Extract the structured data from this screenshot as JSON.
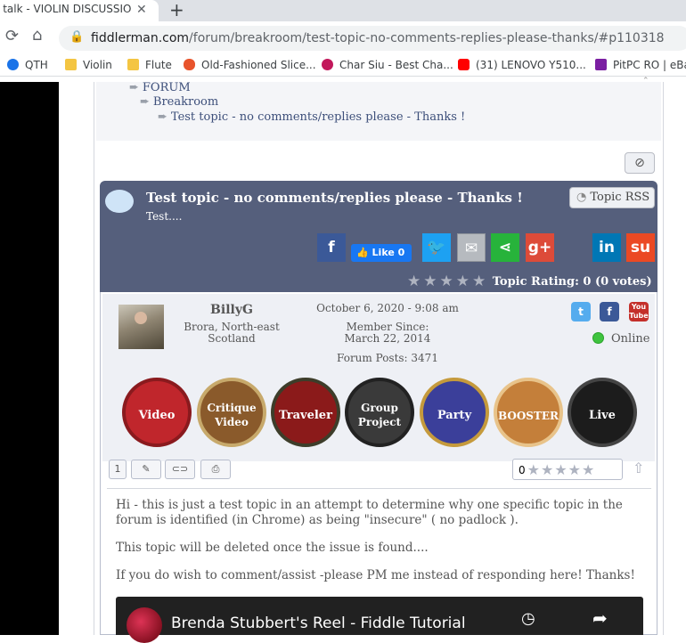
{
  "browser": {
    "tab_title": "e talk - VIOLIN DISCUSSION",
    "tab_close": "✕",
    "new_tab": "+",
    "url_host": "fiddlerman.com",
    "url_path": "/forum/breakroom/test-topic-no-comments-replies-please-thanks/#p110318",
    "bookmarks": [
      {
        "label": "QTH",
        "color": "#1a73e8"
      },
      {
        "label": "Violin",
        "color": "#f4c542"
      },
      {
        "label": "Flute",
        "color": "#f4c542"
      },
      {
        "label": "Old-Fashioned Slice...",
        "color": "#e8542c"
      },
      {
        "label": "Char Siu - Best Cha...",
        "color": "#c2185b"
      },
      {
        "label": "(31) LENOVO Y510...",
        "color": "#ff0000"
      },
      {
        "label": "PitPC RO | eBay",
        "color": "#7b1fa2"
      }
    ]
  },
  "breadcrumb": {
    "root": "FORUM",
    "section": "Breakroom",
    "topic": "Test topic - no comments/replies please - Thanks !"
  },
  "topic": {
    "title": "Test topic - no comments/replies please - Thanks !",
    "subtitle": "Test....",
    "rss_label": "Topic RSS",
    "fb_like": "Like 0",
    "rating_label": "Topic Rating: 0 (0 votes)",
    "share_buttons": [
      {
        "name": "facebook-share-button",
        "glyph": "f",
        "color": "#3b5998"
      },
      {
        "name": "twitter-share-button",
        "glyph": "t",
        "color": "#1da1f2"
      },
      {
        "name": "email-share-button",
        "glyph": "✉",
        "color": "#b6babf"
      },
      {
        "name": "sharethis-share-button",
        "glyph": "<",
        "color": "#27b33b"
      },
      {
        "name": "googleplus-share-button",
        "glyph": "g+",
        "color": "#dd4b39"
      },
      {
        "name": "linkedin-share-button",
        "glyph": "in",
        "color": "#0077b5"
      },
      {
        "name": "stumbleupon-share-button",
        "glyph": "su",
        "color": "#eb4924"
      }
    ]
  },
  "post": {
    "author": "BillyG",
    "location": "Brora, North-east Scotland",
    "date": "October 6, 2020 - 9:08 am",
    "member_since": "Member Since: March 22, 2014",
    "forum_posts": "Forum Posts: 3471",
    "status": "Online",
    "badges": [
      {
        "label": "Video",
        "color": "#c0262c"
      },
      {
        "label": "Critique Video",
        "color": "#8a5a2b"
      },
      {
        "label": "Traveler",
        "color": "#8b1a1a"
      },
      {
        "label": "Group Project",
        "color": "#3a3a3a"
      },
      {
        "label": "Party",
        "color": "#3b3f9a"
      },
      {
        "label": "BOOSTER",
        "color": "#c47f3a"
      },
      {
        "label": "Live",
        "color": "#1c1c1c"
      }
    ],
    "post_number": "1",
    "post_rating": "0",
    "paragraphs": [
      "Hi - this is just a test topic in an attempt to determine why one specific topic in the forum is identified (in Chrome) as being \"insecure\" ( no padlock ).",
      "This topic will be deleted once the issue is found....",
      "If you do wish to comment/assist -please  PM me instead of responding here!  Thanks!"
    ],
    "video_title": "Brenda Stubbert's Reel - Fiddle Tutorial"
  }
}
